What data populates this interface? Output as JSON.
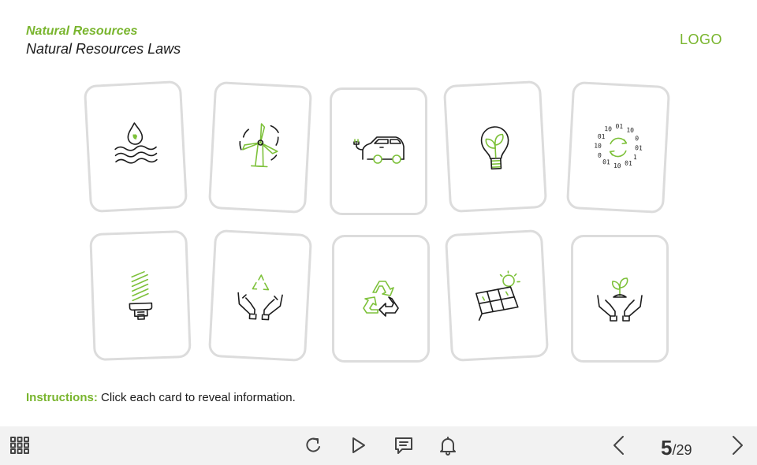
{
  "header": {
    "course_title": "Natural Resources",
    "slide_title": "Natural Resources Laws",
    "logo": "LOGO"
  },
  "colors": {
    "accent": "#79b52e",
    "icon_stroke": "#1c1c1c",
    "card_border": "#dcdcdc",
    "toolbar_bg": "#f2f2f2"
  },
  "cards": [
    {
      "icon": "water-drop-waves-icon"
    },
    {
      "icon": "wind-turbine-icon"
    },
    {
      "icon": "electric-car-icon"
    },
    {
      "icon": "eco-lightbulb-icon"
    },
    {
      "icon": "binary-cycle-icon"
    },
    {
      "icon": "energy-saving-bulb-icon"
    },
    {
      "icon": "hands-recycle-icon"
    },
    {
      "icon": "recycle-arrows-icon"
    },
    {
      "icon": "solar-panel-icon"
    },
    {
      "icon": "hands-seedling-icon"
    }
  ],
  "instructions": {
    "label": "Instructions:",
    "text": " Click each card to reveal information."
  },
  "toolbar": {
    "menu_icon": "grid-menu-icon",
    "replay_icon": "replay-icon",
    "play_icon": "play-icon",
    "notes_icon": "notes-icon",
    "notifications_icon": "bell-icon",
    "prev_icon": "chevron-left-icon",
    "next_icon": "chevron-right-icon",
    "current_page": "5",
    "total_pages": "/29"
  }
}
